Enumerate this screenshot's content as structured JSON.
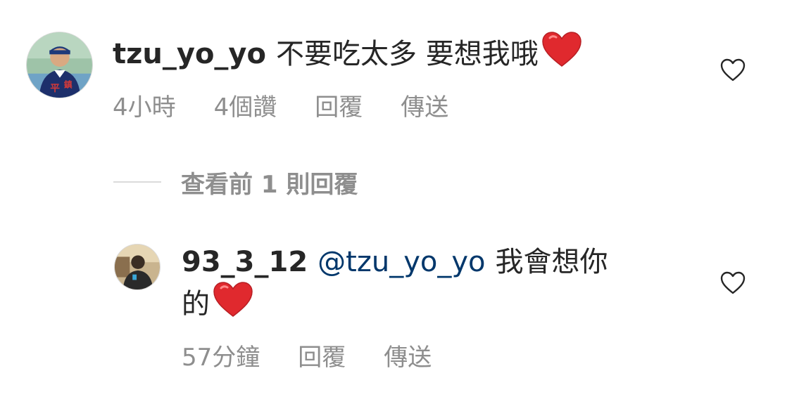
{
  "comment": {
    "username": "tzu_yo_yo",
    "text": "不要吃太多 要想我哦",
    "time": "4小時",
    "likes": "4個讚",
    "reply_label": "回覆",
    "send_label": "傳送",
    "emoji": "red-heart-emoji",
    "avatar_icon": "user-avatar"
  },
  "view_replies": {
    "label": "查看前 1 則回覆"
  },
  "reply": {
    "username": "93_3_12",
    "mention": "@tzu_yo_yo",
    "text_line1": "我會想你",
    "text_line2": "的",
    "time": "57分鐘",
    "reply_label": "回覆",
    "send_label": "傳送",
    "emoji": "red-heart-emoji",
    "avatar_icon": "user-avatar"
  },
  "colors": {
    "text": "#262626",
    "secondary": "#8e8e8e",
    "mention": "#00376b",
    "heart": "#e0292e",
    "divider": "#dbdbdb"
  }
}
